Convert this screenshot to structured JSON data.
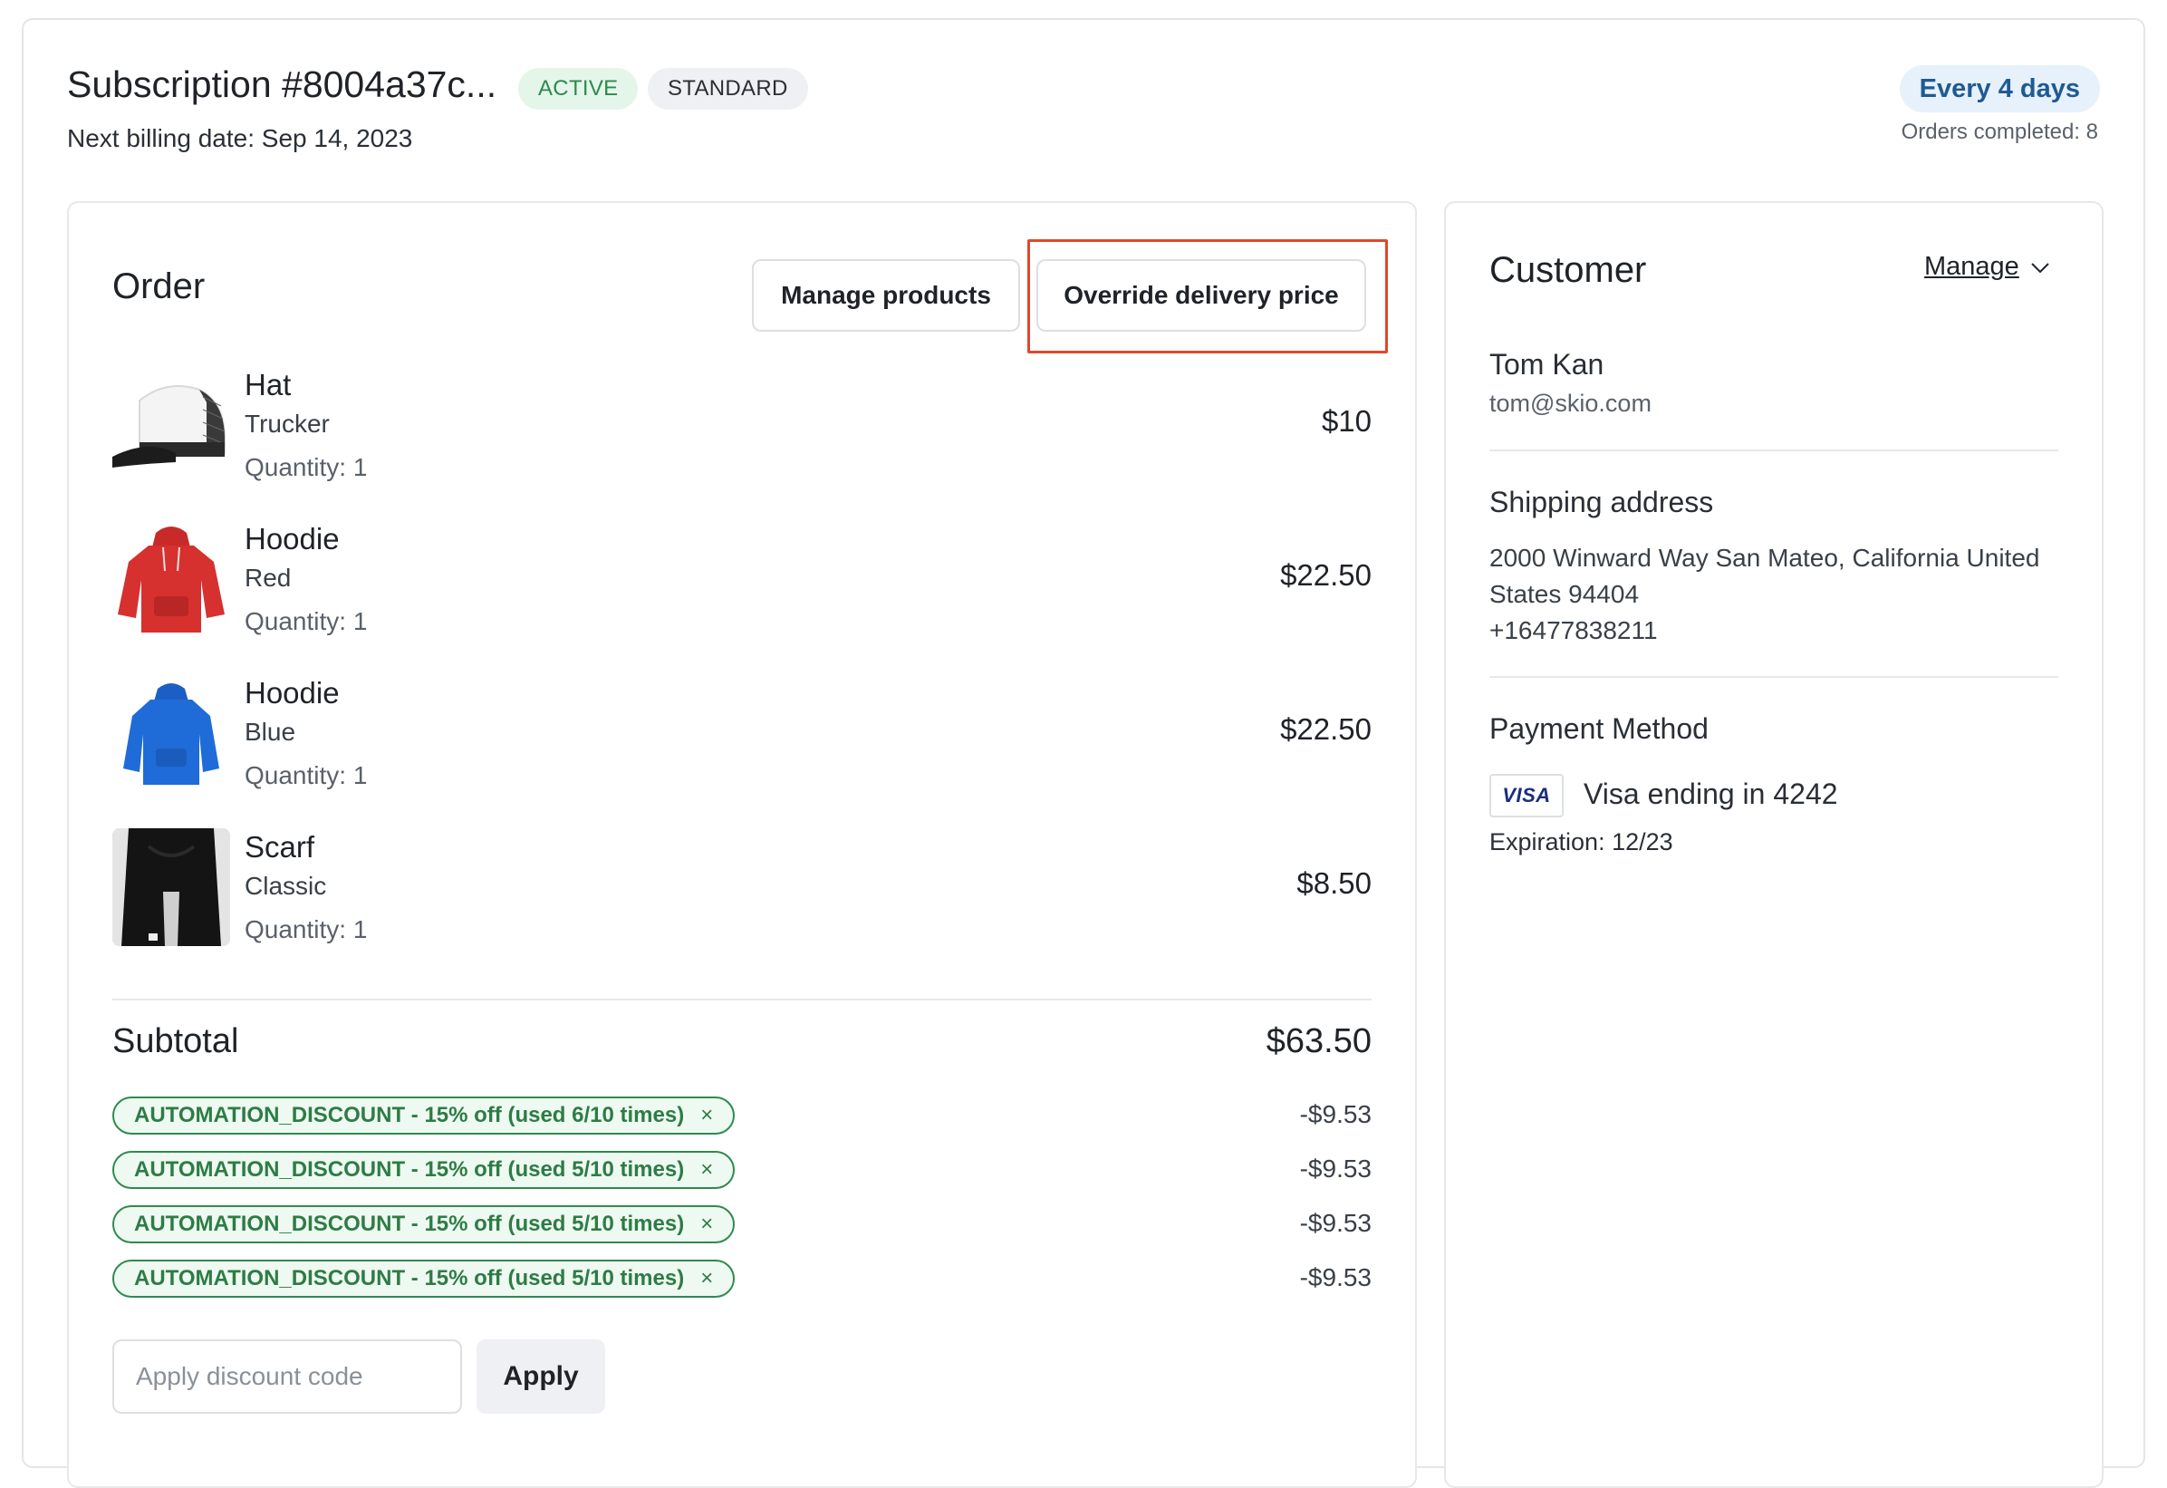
{
  "header": {
    "title": "Subscription #8004a37c...",
    "status_badge": "ACTIVE",
    "plan_badge": "STANDARD",
    "next_billing": "Next billing date: Sep 14, 2023",
    "frequency": "Every 4 days",
    "orders_completed": "Orders completed: 8"
  },
  "order": {
    "title": "Order",
    "manage_products_label": "Manage products",
    "override_delivery_label": "Override delivery price",
    "items": [
      {
        "name": "Hat",
        "variant": "Trucker",
        "quantity": "Quantity: 1",
        "price": "$10",
        "icon": "trucker-hat-image"
      },
      {
        "name": "Hoodie",
        "variant": "Red",
        "quantity": "Quantity: 1",
        "price": "$22.50",
        "icon": "red-hoodie-image"
      },
      {
        "name": "Hoodie",
        "variant": "Blue",
        "quantity": "Quantity: 1",
        "price": "$22.50",
        "icon": "blue-hoodie-image"
      },
      {
        "name": "Scarf",
        "variant": "Classic",
        "quantity": "Quantity: 1",
        "price": "$8.50",
        "icon": "black-scarf-image"
      }
    ],
    "subtotal_label": "Subtotal",
    "subtotal_value": "$63.50",
    "discounts": [
      {
        "label": "AUTOMATION_DISCOUNT - 15% off (used 6/10 times)",
        "amount": "-$9.53"
      },
      {
        "label": "AUTOMATION_DISCOUNT - 15% off (used 5/10 times)",
        "amount": "-$9.53"
      },
      {
        "label": "AUTOMATION_DISCOUNT - 15% off (used 5/10 times)",
        "amount": "-$9.53"
      },
      {
        "label": "AUTOMATION_DISCOUNT - 15% off (used 5/10 times)",
        "amount": "-$9.53"
      }
    ],
    "discount_remove_glyph": "×",
    "discount_placeholder": "Apply discount code",
    "apply_label": "Apply"
  },
  "customer": {
    "title": "Customer",
    "manage_label": "Manage",
    "name": "Tom Kan",
    "email": "tom@skio.com",
    "shipping_title": "Shipping address",
    "address_line": "2000 Winward Way San Mateo, California United States 94404",
    "phone": "+16477838211",
    "payment_title": "Payment Method",
    "card_brand": "VISA",
    "card_text": "Visa ending in 4242",
    "expiration": "Expiration: 12/23"
  },
  "colors": {
    "active_badge_bg": "#e4f6ea",
    "active_badge_text": "#2d8a4e",
    "frequency_bg": "#e6f1fb",
    "frequency_text": "#1f5a92",
    "discount_green": "#2f8a4f",
    "highlight_red": "#e0482a"
  }
}
